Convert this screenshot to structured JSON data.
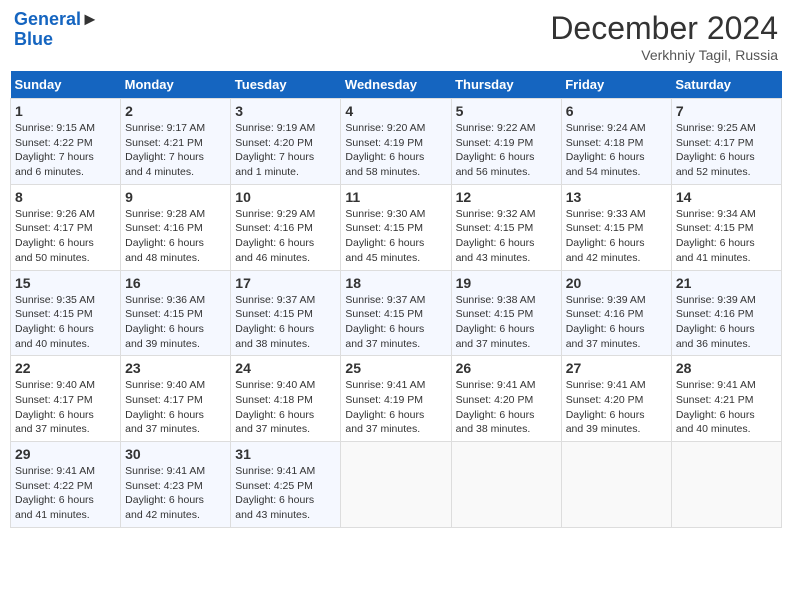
{
  "header": {
    "logo_line1": "General",
    "logo_line2": "Blue",
    "month": "December 2024",
    "location": "Verkhniy Tagil, Russia"
  },
  "days_of_week": [
    "Sunday",
    "Monday",
    "Tuesday",
    "Wednesday",
    "Thursday",
    "Friday",
    "Saturday"
  ],
  "weeks": [
    [
      {
        "day": "1",
        "info": "Sunrise: 9:15 AM\nSunset: 4:22 PM\nDaylight: 7 hours\nand 6 minutes."
      },
      {
        "day": "2",
        "info": "Sunrise: 9:17 AM\nSunset: 4:21 PM\nDaylight: 7 hours\nand 4 minutes."
      },
      {
        "day": "3",
        "info": "Sunrise: 9:19 AM\nSunset: 4:20 PM\nDaylight: 7 hours\nand 1 minute."
      },
      {
        "day": "4",
        "info": "Sunrise: 9:20 AM\nSunset: 4:19 PM\nDaylight: 6 hours\nand 58 minutes."
      },
      {
        "day": "5",
        "info": "Sunrise: 9:22 AM\nSunset: 4:19 PM\nDaylight: 6 hours\nand 56 minutes."
      },
      {
        "day": "6",
        "info": "Sunrise: 9:24 AM\nSunset: 4:18 PM\nDaylight: 6 hours\nand 54 minutes."
      },
      {
        "day": "7",
        "info": "Sunrise: 9:25 AM\nSunset: 4:17 PM\nDaylight: 6 hours\nand 52 minutes."
      }
    ],
    [
      {
        "day": "8",
        "info": "Sunrise: 9:26 AM\nSunset: 4:17 PM\nDaylight: 6 hours\nand 50 minutes."
      },
      {
        "day": "9",
        "info": "Sunrise: 9:28 AM\nSunset: 4:16 PM\nDaylight: 6 hours\nand 48 minutes."
      },
      {
        "day": "10",
        "info": "Sunrise: 9:29 AM\nSunset: 4:16 PM\nDaylight: 6 hours\nand 46 minutes."
      },
      {
        "day": "11",
        "info": "Sunrise: 9:30 AM\nSunset: 4:15 PM\nDaylight: 6 hours\nand 45 minutes."
      },
      {
        "day": "12",
        "info": "Sunrise: 9:32 AM\nSunset: 4:15 PM\nDaylight: 6 hours\nand 43 minutes."
      },
      {
        "day": "13",
        "info": "Sunrise: 9:33 AM\nSunset: 4:15 PM\nDaylight: 6 hours\nand 42 minutes."
      },
      {
        "day": "14",
        "info": "Sunrise: 9:34 AM\nSunset: 4:15 PM\nDaylight: 6 hours\nand 41 minutes."
      }
    ],
    [
      {
        "day": "15",
        "info": "Sunrise: 9:35 AM\nSunset: 4:15 PM\nDaylight: 6 hours\nand 40 minutes."
      },
      {
        "day": "16",
        "info": "Sunrise: 9:36 AM\nSunset: 4:15 PM\nDaylight: 6 hours\nand 39 minutes."
      },
      {
        "day": "17",
        "info": "Sunrise: 9:37 AM\nSunset: 4:15 PM\nDaylight: 6 hours\nand 38 minutes."
      },
      {
        "day": "18",
        "info": "Sunrise: 9:37 AM\nSunset: 4:15 PM\nDaylight: 6 hours\nand 37 minutes."
      },
      {
        "day": "19",
        "info": "Sunrise: 9:38 AM\nSunset: 4:15 PM\nDaylight: 6 hours\nand 37 minutes."
      },
      {
        "day": "20",
        "info": "Sunrise: 9:39 AM\nSunset: 4:16 PM\nDaylight: 6 hours\nand 37 minutes."
      },
      {
        "day": "21",
        "info": "Sunrise: 9:39 AM\nSunset: 4:16 PM\nDaylight: 6 hours\nand 36 minutes."
      }
    ],
    [
      {
        "day": "22",
        "info": "Sunrise: 9:40 AM\nSunset: 4:17 PM\nDaylight: 6 hours\nand 37 minutes."
      },
      {
        "day": "23",
        "info": "Sunrise: 9:40 AM\nSunset: 4:17 PM\nDaylight: 6 hours\nand 37 minutes."
      },
      {
        "day": "24",
        "info": "Sunrise: 9:40 AM\nSunset: 4:18 PM\nDaylight: 6 hours\nand 37 minutes."
      },
      {
        "day": "25",
        "info": "Sunrise: 9:41 AM\nSunset: 4:19 PM\nDaylight: 6 hours\nand 37 minutes."
      },
      {
        "day": "26",
        "info": "Sunrise: 9:41 AM\nSunset: 4:20 PM\nDaylight: 6 hours\nand 38 minutes."
      },
      {
        "day": "27",
        "info": "Sunrise: 9:41 AM\nSunset: 4:20 PM\nDaylight: 6 hours\nand 39 minutes."
      },
      {
        "day": "28",
        "info": "Sunrise: 9:41 AM\nSunset: 4:21 PM\nDaylight: 6 hours\nand 40 minutes."
      }
    ],
    [
      {
        "day": "29",
        "info": "Sunrise: 9:41 AM\nSunset: 4:22 PM\nDaylight: 6 hours\nand 41 minutes."
      },
      {
        "day": "30",
        "info": "Sunrise: 9:41 AM\nSunset: 4:23 PM\nDaylight: 6 hours\nand 42 minutes."
      },
      {
        "day": "31",
        "info": "Sunrise: 9:41 AM\nSunset: 4:25 PM\nDaylight: 6 hours\nand 43 minutes."
      },
      {
        "day": "",
        "info": ""
      },
      {
        "day": "",
        "info": ""
      },
      {
        "day": "",
        "info": ""
      },
      {
        "day": "",
        "info": ""
      }
    ]
  ]
}
